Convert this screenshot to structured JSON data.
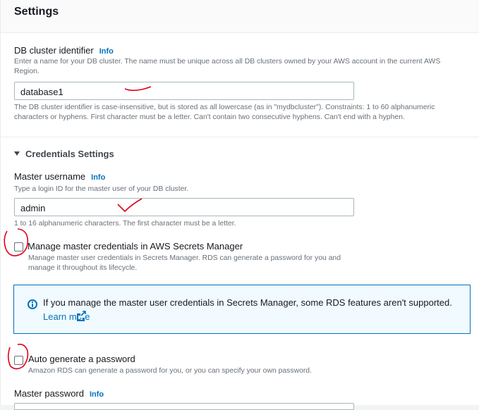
{
  "settings": {
    "title": "Settings"
  },
  "db_cluster": {
    "label": "DB cluster identifier",
    "info": "Info",
    "description": "Enter a name for your DB cluster. The name must be unique across all DB clusters owned by your AWS account in the current AWS Region.",
    "value": "database1",
    "constraint": "The DB cluster identifier is case-insensitive, but is stored as all lowercase (as in \"mydbcluster\"). Constraints: 1 to 60 alphanumeric characters or hyphens. First character must be a letter. Can't contain two consecutive hyphens. Can't end with a hyphen."
  },
  "credentials": {
    "section_title": "Credentials Settings",
    "master_username_label": "Master username",
    "info": "Info",
    "master_username_desc": "Type a login ID for the master user of your DB cluster.",
    "master_username_value": "admin",
    "master_username_constraint": "1 to 16 alphanumeric characters. The first character must be a letter.",
    "manage_label": "Manage master credentials in AWS Secrets Manager",
    "manage_desc": "Manage master user credentials in Secrets Manager. RDS can generate a password for you and manage it throughout its lifecycle.",
    "alert_text": "If you manage the master user credentials in Secrets Manager, some RDS features aren't supported.",
    "alert_link": "Learn more",
    "auto_label": "Auto generate a password",
    "auto_desc": "Amazon RDS can generate a password for you, or you can specify your own password.",
    "master_password_label": "Master password",
    "master_password_info": "Info"
  },
  "icons": {
    "info": "info-circle-icon",
    "external": "external-link-icon",
    "caret": "caret-down-icon"
  },
  "colors": {
    "link": "#0073bb",
    "annotation": "#e0001b"
  }
}
